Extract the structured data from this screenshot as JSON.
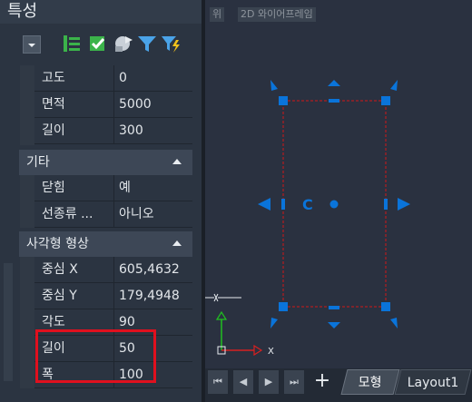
{
  "palette": {
    "title": "특성",
    "rows_top": [
      {
        "label": "고도",
        "value": "0"
      },
      {
        "label": "면적",
        "value": "5000"
      },
      {
        "label": "길이",
        "value": "300"
      }
    ],
    "section_misc": {
      "title": "기타",
      "rows": [
        {
          "label": "닫힘",
          "value": "예"
        },
        {
          "label": "선종류 ...",
          "value": "아니오"
        }
      ]
    },
    "section_rect": {
      "title": "사각형 형상",
      "rows": [
        {
          "label": "중심 X",
          "value": "605,4632"
        },
        {
          "label": "중심 Y",
          "value": "179,4948"
        },
        {
          "label": "각도",
          "value": "90"
        },
        {
          "label": "길이",
          "value": "50"
        },
        {
          "label": "폭",
          "value": "100"
        }
      ]
    }
  },
  "viewport": {
    "view_label": "위",
    "style_label": "2D 와이어프레임",
    "center_glyph": "C",
    "ucs_x": "X",
    "ucs_y": "Y"
  },
  "layout_tabs": {
    "model": "모형",
    "layout1": "Layout1",
    "add": "+"
  },
  "colors": {
    "grip": "#0a74da",
    "rect_line": "#d01818",
    "highlight": "#e0101e",
    "ucs_x": "#d82020",
    "ucs_y": "#20c020"
  }
}
